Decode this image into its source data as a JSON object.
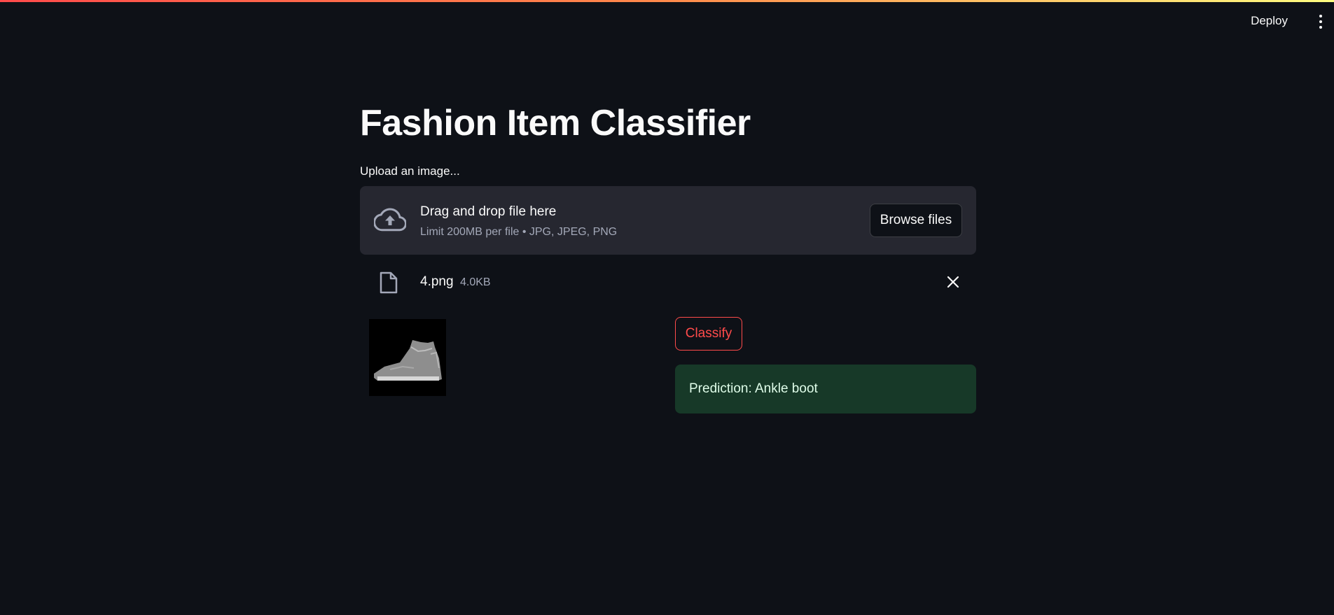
{
  "header": {
    "deploy_label": "Deploy",
    "menu_icon": "kebab-menu-icon"
  },
  "main": {
    "title": "Fashion Item Classifier",
    "uploader": {
      "label": "Upload an image...",
      "drop_title": "Drag and drop file here",
      "drop_subtitle": "Limit 200MB per file • JPG, JPEG, PNG",
      "browse_label": "Browse files",
      "icon": "cloud-upload-icon"
    },
    "file": {
      "name": "4.png",
      "size": "4.0KB",
      "icon": "file-icon"
    },
    "classify_label": "Classify",
    "prediction": "Prediction: Ankle boot"
  },
  "colors": {
    "background": "#0e1117",
    "accent": "#ff4b4b",
    "dropzone": "#262730",
    "success_bg": "#173928",
    "success_text": "#dffde9"
  }
}
